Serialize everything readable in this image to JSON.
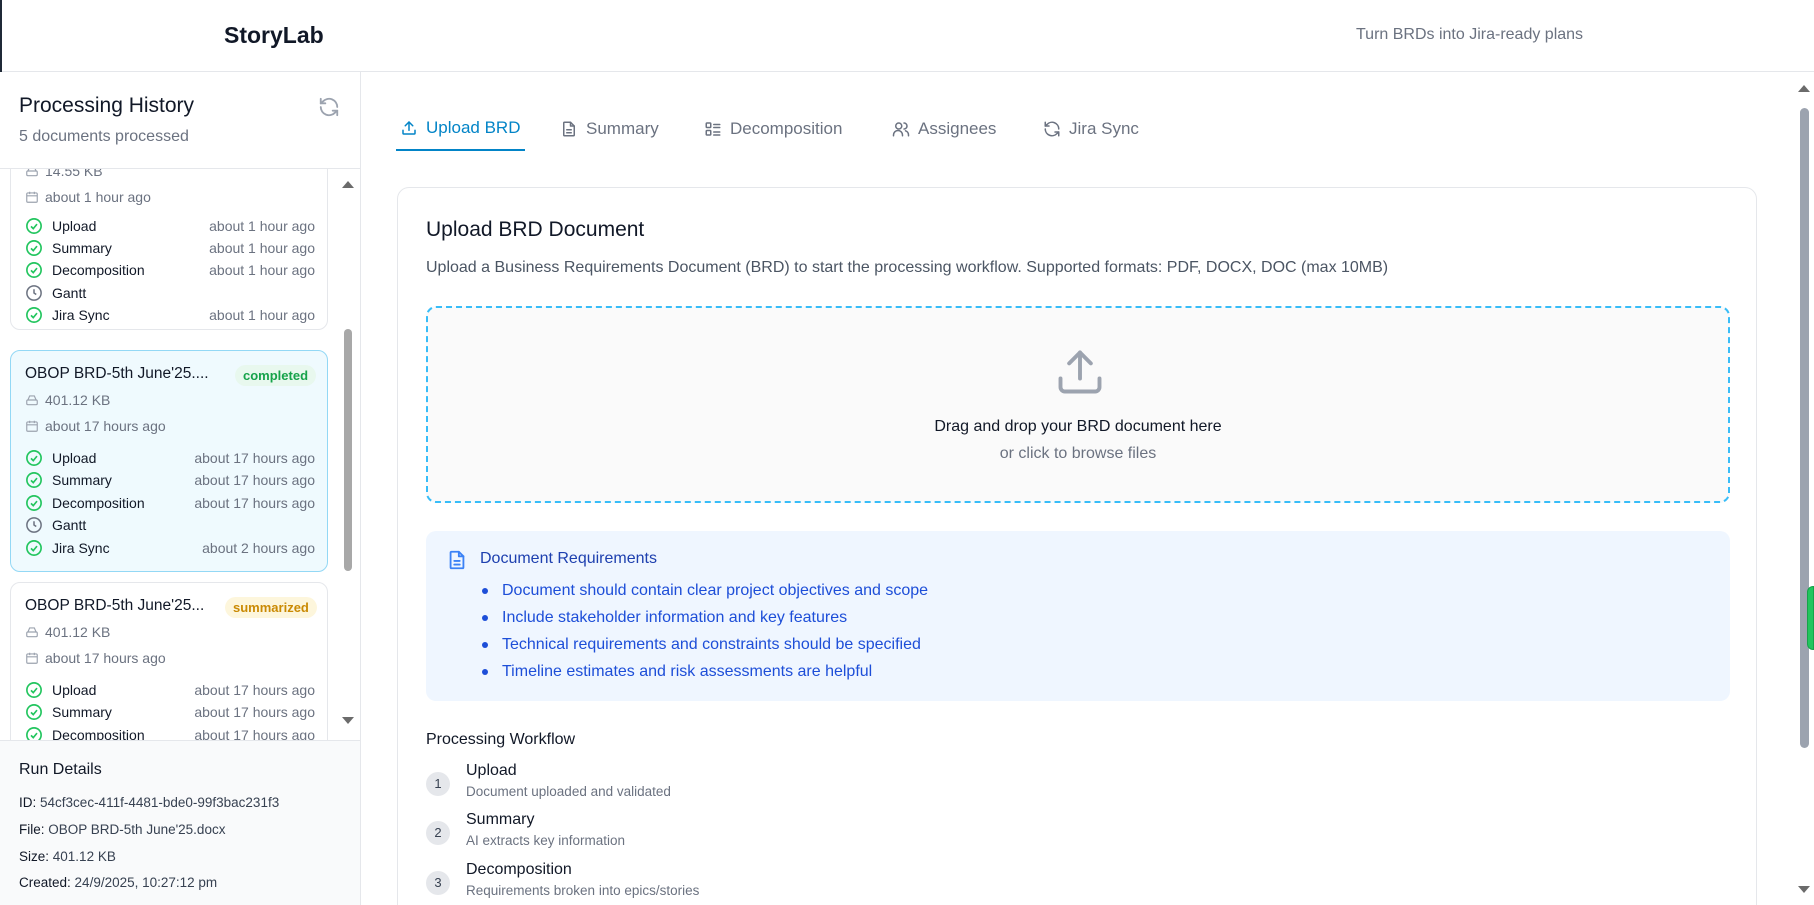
{
  "app": {
    "name": "StoryLab",
    "tagline": "Turn BRDs into Jira-ready plans"
  },
  "sidebar": {
    "title": "Processing History",
    "subtitle": "5 documents processed",
    "cards": [
      {
        "name": "",
        "status": "",
        "size": "14.55 KB",
        "time": "about 1 hour ago",
        "steps": [
          {
            "name": "Upload",
            "time": "about 1 hour ago",
            "done": true
          },
          {
            "name": "Summary",
            "time": "about 1 hour ago",
            "done": true
          },
          {
            "name": "Decomposition",
            "time": "about 1 hour ago",
            "done": true
          },
          {
            "name": "Gantt",
            "time": "",
            "done": false
          },
          {
            "name": "Jira Sync",
            "time": "about 1 hour ago",
            "done": true
          }
        ]
      },
      {
        "name": "OBOP BRD-5th June'25....",
        "status": "completed",
        "size": "401.12 KB",
        "time": "about 17 hours ago",
        "steps": [
          {
            "name": "Upload",
            "time": "about 17 hours ago",
            "done": true
          },
          {
            "name": "Summary",
            "time": "about 17 hours ago",
            "done": true
          },
          {
            "name": "Decomposition",
            "time": "about 17 hours ago",
            "done": true
          },
          {
            "name": "Gantt",
            "time": "",
            "done": false
          },
          {
            "name": "Jira Sync",
            "time": "about 2 hours ago",
            "done": true
          }
        ]
      },
      {
        "name": "OBOP BRD-5th June'25...",
        "status": "summarized",
        "size": "401.12 KB",
        "time": "about 17 hours ago",
        "steps": [
          {
            "name": "Upload",
            "time": "about 17 hours ago",
            "done": true
          },
          {
            "name": "Summary",
            "time": "about 17 hours ago",
            "done": true
          },
          {
            "name": "Decomposition",
            "time": "about 17 hours ago",
            "done": true
          }
        ]
      }
    ],
    "run_details": {
      "title": "Run Details",
      "id_label": "ID:",
      "id_value": "54cf3cec-411f-4481-bde0-99f3bac231f3",
      "file_label": "File:",
      "file_value": "OBOP BRD-5th June'25.docx",
      "size_label": "Size:",
      "size_value": "401.12 KB",
      "created_label": "Created:",
      "created_value": "24/9/2025, 10:27:12 pm"
    }
  },
  "tabs": [
    {
      "label": "Upload BRD",
      "icon": "upload-icon",
      "active": true
    },
    {
      "label": "Summary",
      "icon": "document-icon",
      "active": false
    },
    {
      "label": "Decomposition",
      "icon": "list-icon",
      "active": false
    },
    {
      "label": "Assignees",
      "icon": "users-icon",
      "active": false
    },
    {
      "label": "Jira Sync",
      "icon": "refresh-icon",
      "active": false
    }
  ],
  "upload": {
    "title": "Upload BRD Document",
    "description": "Upload a Business Requirements Document (BRD) to start the processing workflow. Supported formats: PDF, DOCX, DOC (max 10MB)",
    "drop_main": "Drag and drop your BRD document here",
    "drop_sub": "or click to browse files"
  },
  "requirements": {
    "title": "Document Requirements",
    "items": [
      "Document should contain clear project objectives and scope",
      "Include stakeholder information and key features",
      "Technical requirements and constraints should be specified",
      "Timeline estimates and risk assessments are helpful"
    ]
  },
  "workflow": {
    "title": "Processing Workflow",
    "steps": [
      {
        "num": "1",
        "name": "Upload",
        "desc": "Document uploaded and validated"
      },
      {
        "num": "2",
        "name": "Summary",
        "desc": "AI extracts key information"
      },
      {
        "num": "3",
        "name": "Decomposition",
        "desc": "Requirements broken into epics/stories"
      }
    ]
  },
  "colors": {
    "accent": "#0284c7",
    "done": "#22c55e",
    "pending": "#6b7280",
    "completed_badge": "#16a34a",
    "summarized_badge": "#ca8a04"
  }
}
